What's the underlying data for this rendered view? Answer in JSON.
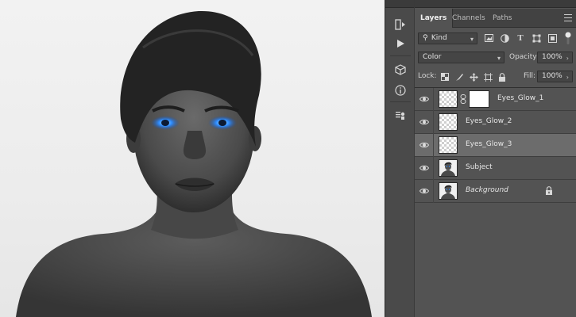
{
  "panel": {
    "tabs": [
      {
        "label": "Layers",
        "active": true
      },
      {
        "label": "Channels",
        "active": false
      },
      {
        "label": "Paths",
        "active": false
      }
    ],
    "filter": {
      "kind_label": "Kind"
    },
    "blend": {
      "mode": "Color",
      "opacity_label": "Opacity:",
      "opacity_value": "100%"
    },
    "lock": {
      "label": "Lock:",
      "fill_label": "Fill:",
      "fill_value": "100%"
    },
    "layers": [
      {
        "name": "Eyes_Glow_1",
        "thumb": "transparent",
        "has_mask": true,
        "selected": false,
        "locked": false,
        "italic": false
      },
      {
        "name": "Eyes_Glow_2",
        "thumb": "transparent",
        "has_mask": false,
        "selected": false,
        "locked": false,
        "italic": false
      },
      {
        "name": "Eyes_Glow_3",
        "thumb": "transparent",
        "has_mask": false,
        "selected": true,
        "locked": false,
        "italic": false
      },
      {
        "name": "Subject",
        "thumb": "photo",
        "has_mask": false,
        "selected": false,
        "locked": false,
        "italic": false
      },
      {
        "name": "Background",
        "thumb": "photo",
        "has_mask": false,
        "selected": false,
        "locked": true,
        "italic": true
      }
    ]
  },
  "toolstrip": {
    "tools": [
      "history-play-icon",
      "play-icon",
      "3d-cube-icon",
      "info-icon",
      "clone-source-icon"
    ]
  },
  "colors": {
    "eye_glow": "#2f8dff",
    "selected_layer": "#6c6c6c",
    "panel_bg": "#535353"
  }
}
